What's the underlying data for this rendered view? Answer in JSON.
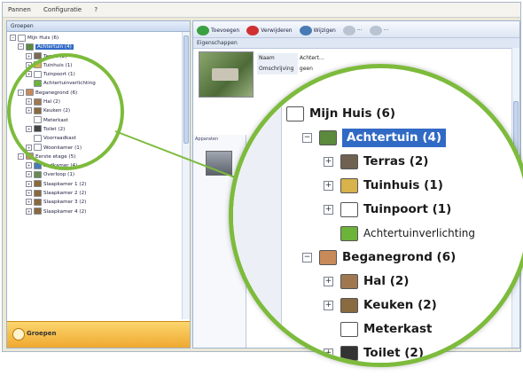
{
  "menu": [
    "Pannen",
    "Configuratie",
    "?"
  ],
  "left_pane": {
    "header": "Groepen",
    "tree": [
      {
        "indent": 0,
        "exp": "−",
        "icon": "house-icon",
        "color": "#ffffff",
        "label": "Mijn Huis (6)",
        "selected": false
      },
      {
        "indent": 1,
        "exp": "−",
        "icon": "garden-icon",
        "color": "#5b8a3c",
        "label": "Achtertuin (4)",
        "selected": true
      },
      {
        "indent": 2,
        "exp": "+",
        "icon": "terrace-icon",
        "color": "#7a6a55",
        "label": "Terras (2)",
        "selected": false
      },
      {
        "indent": 2,
        "exp": "+",
        "icon": "gazebo-icon",
        "color": "#d8b24a",
        "label": "Tuinhuis (1)",
        "selected": false
      },
      {
        "indent": 2,
        "exp": "+",
        "icon": "gate-icon",
        "color": "#ffffff",
        "label": "Tuinpoort (1)",
        "selected": false
      },
      {
        "indent": 2,
        "exp": "",
        "icon": "light-icon",
        "color": "#6cb33a",
        "label": "Achtertuinverlichting",
        "selected": false
      },
      {
        "indent": 1,
        "exp": "−",
        "icon": "floor-icon",
        "color": "#c98a5a",
        "label": "Beganegrond (6)",
        "selected": false
      },
      {
        "indent": 2,
        "exp": "+",
        "icon": "hall-icon",
        "color": "#a07850",
        "label": "Hal (2)",
        "selected": false
      },
      {
        "indent": 2,
        "exp": "+",
        "icon": "kitchen-icon",
        "color": "#8a6a40",
        "label": "Keuken (2)",
        "selected": false
      },
      {
        "indent": 2,
        "exp": "",
        "icon": "closet-icon",
        "color": "#ffffff",
        "label": "Meterkast",
        "selected": false
      },
      {
        "indent": 2,
        "exp": "+",
        "icon": "toilet-icon",
        "color": "#444444",
        "label": "Toilet (2)",
        "selected": false
      },
      {
        "indent": 2,
        "exp": "",
        "icon": "room-icon",
        "color": "#ffffff",
        "label": "Voorraadkast",
        "selected": false
      },
      {
        "indent": 2,
        "exp": "+",
        "icon": "livingroom-icon",
        "color": "#ffffff",
        "label": "Woonkamer (1)",
        "selected": false
      },
      {
        "indent": 1,
        "exp": "−",
        "icon": "floor-icon",
        "color": "#c98a5a",
        "label": "Eerste etage (5)",
        "selected": false
      },
      {
        "indent": 2,
        "exp": "+",
        "icon": "bathroom-icon",
        "color": "#4a7ab5",
        "label": "Badkamer (4)",
        "selected": false
      },
      {
        "indent": 2,
        "exp": "+",
        "icon": "landing-icon",
        "color": "#6a8a50",
        "label": "Overloop (1)",
        "selected": false
      },
      {
        "indent": 2,
        "exp": "+",
        "icon": "bedroom-icon",
        "color": "#8a6a3a",
        "label": "Slaapkamer 1 (2)",
        "selected": false
      },
      {
        "indent": 2,
        "exp": "+",
        "icon": "bedroom-icon",
        "color": "#8a6a3a",
        "label": "Slaapkamer 2 (2)",
        "selected": false
      },
      {
        "indent": 2,
        "exp": "+",
        "icon": "bedroom-icon",
        "color": "#8a6a3a",
        "label": "Slaapkamer 3 (2)",
        "selected": false
      },
      {
        "indent": 2,
        "exp": "+",
        "icon": "bedroom-icon",
        "color": "#8a6a3a",
        "label": "Slaapkamer 4 (2)",
        "selected": false
      }
    ],
    "footer": "Groepen"
  },
  "right_pane": {
    "toolbar": [
      {
        "icon": "new-icon",
        "color": "#3aa040",
        "label": "Toevoegen"
      },
      {
        "icon": "delete-icon",
        "color": "#d03030",
        "label": "Verwijderen"
      },
      {
        "icon": "edit-icon",
        "color": "#4a7ab5",
        "label": "Wijzigen"
      },
      {
        "icon": "disabled-icon",
        "color": "#b9c3d2",
        "label": "···"
      },
      {
        "icon": "disabled-icon",
        "color": "#b9c3d2",
        "label": "···"
      }
    ],
    "subheader": "Eigenschappen",
    "properties": [
      {
        "key": "Naam",
        "value": "Achtert…"
      },
      {
        "key": "Omschrijving",
        "value": "geen"
      }
    ],
    "lower_label": "Apparaten"
  },
  "zoom": {
    "tree": [
      {
        "level": 0,
        "exp": "",
        "icon": "house-icon",
        "color": "#ffffff",
        "label": "Mijn Huis (6)",
        "selected": false,
        "bold": true
      },
      {
        "level": 1,
        "exp": "−",
        "icon": "garden-icon",
        "color": "#5b8a3c",
        "label": "Achtertuin (4)",
        "selected": true,
        "bold": true
      },
      {
        "level": 2,
        "exp": "+",
        "icon": "terrace-icon",
        "color": "#6f6252",
        "label": "Terras (2)",
        "selected": false,
        "bold": true
      },
      {
        "level": 2,
        "exp": "+",
        "icon": "gazebo-icon",
        "color": "#d8b24a",
        "label": "Tuinhuis (1)",
        "selected": false,
        "bold": true
      },
      {
        "level": 2,
        "exp": "+",
        "icon": "gate-icon",
        "color": "#ffffff",
        "label": "Tuinpoort (1)",
        "selected": false,
        "bold": true
      },
      {
        "level": 2,
        "exp": "",
        "icon": "light-icon",
        "color": "#6cb33a",
        "label": "Achtertuinverlichting",
        "selected": false,
        "bold": false
      },
      {
        "level": 1,
        "exp": "−",
        "icon": "floor-icon",
        "color": "#c98a5a",
        "label": "Beganegrond (6)",
        "selected": false,
        "bold": true
      },
      {
        "level": 2,
        "exp": "+",
        "icon": "hall-icon",
        "color": "#a07850",
        "label": "Hal (2)",
        "selected": false,
        "bold": true
      },
      {
        "level": 2,
        "exp": "+",
        "icon": "kitchen-icon",
        "color": "#8a6a40",
        "label": "Keuken (2)",
        "selected": false,
        "bold": true
      },
      {
        "level": 2,
        "exp": "",
        "icon": "closet-icon",
        "color": "#ffffff",
        "label": "Meterkast",
        "selected": false,
        "bold": true
      },
      {
        "level": 2,
        "exp": "+",
        "icon": "toilet-icon",
        "color": "#333333",
        "label": "Toilet (2)",
        "selected": false,
        "bold": true
      }
    ]
  },
  "accent": "#7dbb3c",
  "selection_color": "#316ac5"
}
